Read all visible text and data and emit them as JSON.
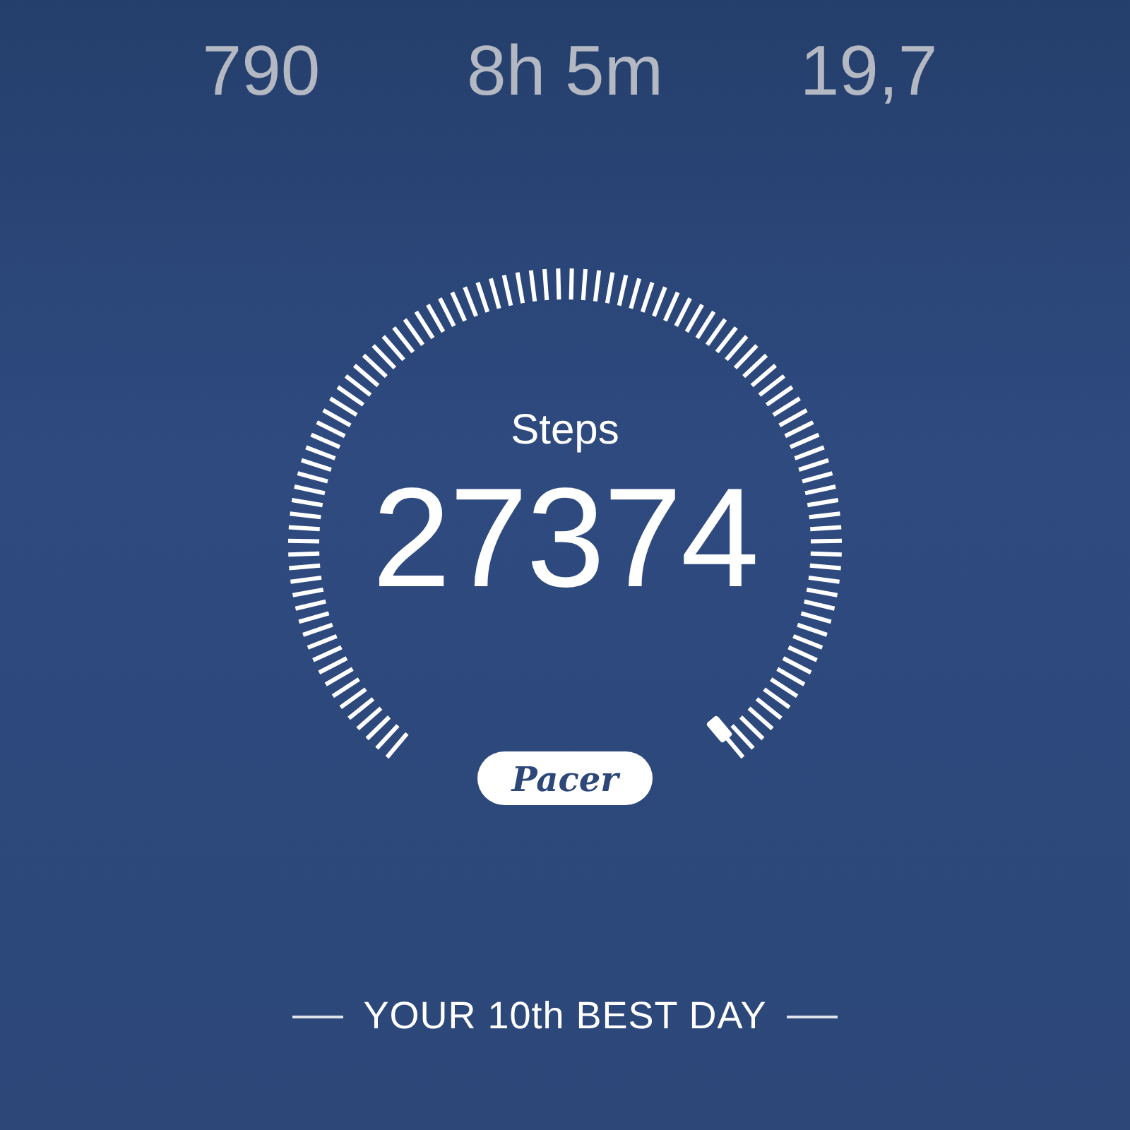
{
  "stats": [
    {
      "value": "790"
    },
    {
      "value": "8h 5m"
    },
    {
      "value": "19,7"
    }
  ],
  "gauge": {
    "label": "Steps",
    "value": "27374"
  },
  "brand": {
    "logo": "Pacer"
  },
  "footer": {
    "rank": "YOUR 10th BEST DAY"
  }
}
